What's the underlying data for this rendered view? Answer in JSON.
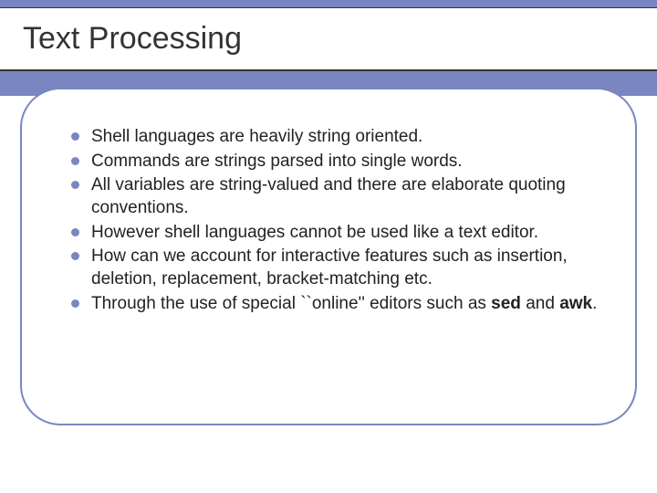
{
  "title": "Text Processing",
  "bullets": [
    {
      "text": "Shell languages are heavily string oriented."
    },
    {
      "text": "Commands are strings parsed into single words."
    },
    {
      "text": "All variables are string-valued and there are elaborate quoting conventions."
    },
    {
      "text": "However shell languages cannot be used like a text editor."
    },
    {
      "text": "How can we account for interactive features such as insertion, deletion, replacement, bracket-matching etc."
    },
    {
      "prefix": "Through the use of special ``online'' editors such as ",
      "bold1": "sed",
      "mid": " and ",
      "bold2": "awk",
      "suffix": "."
    }
  ]
}
